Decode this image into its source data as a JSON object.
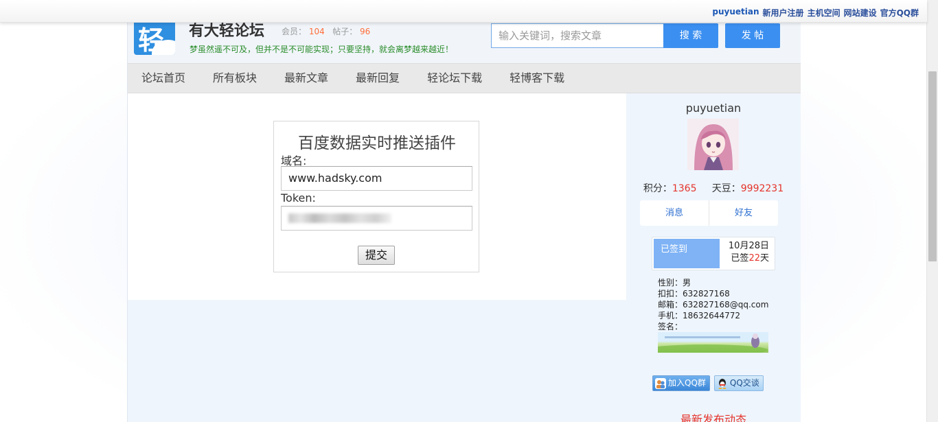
{
  "topbar": {
    "username": "puyuetian",
    "links": [
      "新用户注册",
      "主机空间",
      "网站建设",
      "官方QQ群"
    ]
  },
  "header": {
    "logo_char": "轻",
    "site_name": "有大轻论坛",
    "members_label": "会员：",
    "members_count": "104",
    "posts_label": "帖子：",
    "posts_count": "96",
    "motto": "梦虽然遥不可及，但并不是不可能实现；只要坚持，就会离梦越来越近！",
    "search_placeholder": "输入关键词，搜索文章",
    "search_label": "搜 索",
    "post_label": "发 帖"
  },
  "nav": [
    "论坛首页",
    "所有板块",
    "最新文章",
    "最新回复",
    "轻论坛下载",
    "轻博客下载"
  ],
  "form": {
    "title": "百度数据实时推送插件",
    "domain_label": "域名:",
    "domain_value": "www.hadsky.com",
    "token_label": "Token:",
    "submit_label": "提交"
  },
  "sidebar": {
    "username": "puyuetian",
    "points_label": "积分：",
    "points_value": "1365",
    "beans_label": "天豆：",
    "beans_value": "9992231",
    "messages_label": "消息",
    "friends_label": "好友",
    "signed_label": "已签到",
    "sign_date": "10月28日",
    "signed_prefix": "已签",
    "signed_days": "22",
    "signed_suffix": "天",
    "info": [
      "性别：男",
      "扣扣：632827168",
      "邮箱：632827168@qq.com",
      "手机：18632644772",
      "签名："
    ],
    "join_qq_group": "加入QQ群",
    "qq_chat": "QQ交谈",
    "latest_title": "最新发布动态"
  },
  "colors": {
    "accent": "#3b8ff0",
    "highlight": "#e5332a",
    "stats": "#ff6d3a",
    "motto": "#2a8c2a"
  }
}
